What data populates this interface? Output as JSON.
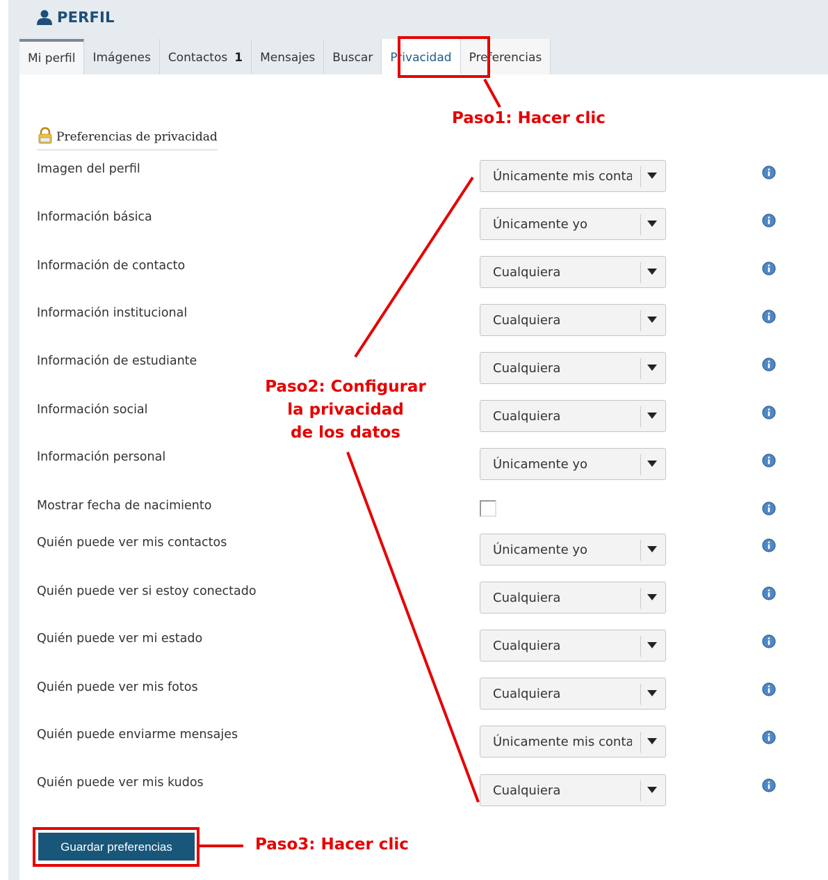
{
  "header": {
    "title": "PERFIL",
    "icon": "user-icon"
  },
  "tabs": [
    {
      "label": "Mi perfil"
    },
    {
      "label": "Imágenes"
    },
    {
      "label": "Contactos",
      "count": "1"
    },
    {
      "label": "Mensajes"
    },
    {
      "label": "Buscar"
    },
    {
      "label": "Privacidad",
      "active": true
    },
    {
      "label": "Preferencias"
    }
  ],
  "section": {
    "title": "Preferencias de privacidad",
    "icon": "lock-icon"
  },
  "settings": [
    {
      "label": "Imagen del perfil",
      "value": "Únicamente mis contactos"
    },
    {
      "label": "Información básica",
      "value": "Únicamente yo"
    },
    {
      "label": "Información de contacto",
      "value": "Cualquiera"
    },
    {
      "label": "Información institucional",
      "value": "Cualquiera"
    },
    {
      "label": "Información de estudiante",
      "value": "Cualquiera"
    },
    {
      "label": "Información social",
      "value": "Cualquiera"
    },
    {
      "label": "Información personal",
      "value": "Únicamente yo"
    },
    {
      "label": "Mostrar fecha de nacimiento",
      "checked": false
    },
    {
      "label": "Quién puede ver mis contactos",
      "value": "Únicamente yo"
    },
    {
      "label": "Quién puede ver si estoy conectado",
      "value": "Cualquiera"
    },
    {
      "label": "Quién puede ver mi estado",
      "value": "Cualquiera"
    },
    {
      "label": "Quién puede ver mis fotos",
      "value": "Cualquiera"
    },
    {
      "label": "Quién puede enviarme mensajes",
      "value": "Únicamente mis contactos"
    },
    {
      "label": "Quién puede ver mis kudos",
      "value": "Cualquiera"
    }
  ],
  "save_button": "Guardar preferencias",
  "annotations": {
    "step1": "Paso1: Hacer clic",
    "step2_line1": "Paso2: Configurar",
    "step2_line2": "la privacidad",
    "step2_line3": "de los datos",
    "step3": "Paso3: Hacer clic"
  },
  "colors": {
    "annotation": "#e60000",
    "title": "#1f4e79",
    "button": "#18567a",
    "active_tab_text": "#1f5e8c"
  }
}
